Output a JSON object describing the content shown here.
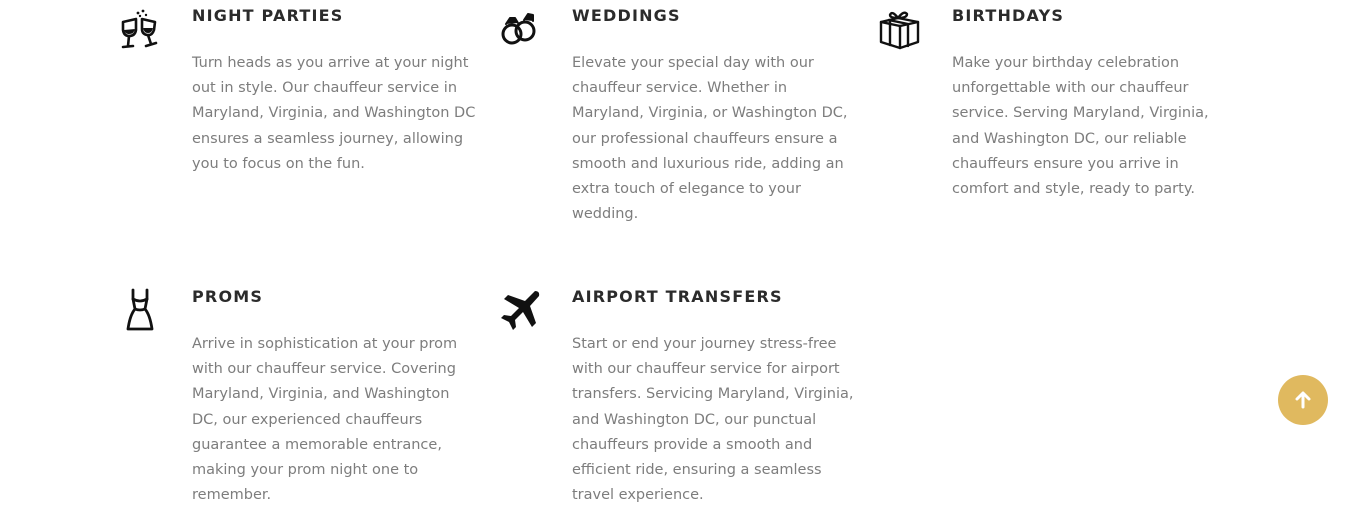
{
  "services": [
    {
      "icon": "champagne-glasses-icon",
      "title": "NIGHT PARTIES",
      "description": "Turn heads as you arrive at your night out in style. Our chauffeur service in Maryland, Virginia, and Washington DC ensures a seamless journey, allowing you to focus on the fun."
    },
    {
      "icon": "wedding-rings-icon",
      "title": "WEDDINGS",
      "description": "Elevate your special day with our chauffeur service. Whether in Maryland, Virginia, or Washington DC, our professional chauffeurs ensure a smooth and luxurious ride, adding an extra touch of elegance to your wedding."
    },
    {
      "icon": "gift-box-icon",
      "title": "BIRTHDAYS",
      "description": "Make your birthday celebration unforgettable with our chauffeur service. Serving Maryland, Virginia, and Washington DC, our reliable chauffeurs ensure you arrive in comfort and style, ready to party."
    },
    {
      "icon": "dress-icon",
      "title": "PROMS",
      "description": "Arrive in sophistication at your prom with our chauffeur service. Covering Maryland, Virginia, and Washington DC, our experienced chauffeurs guarantee a memorable entrance, making your prom night one to remember."
    },
    {
      "icon": "airplane-icon",
      "title": "AIRPORT TRANSFERS",
      "description": "Start or end your journey stress-free with our chauffeur service for airport transfers. Servicing Maryland, Virginia, and Washington DC, our punctual chauffeurs provide a smooth and efficient ride, ensuring a seamless travel experience."
    }
  ],
  "back_to_top": {
    "icon": "arrow-up-icon",
    "color": "#e0b95f"
  },
  "colors": {
    "heading": "#2b2b2b",
    "body_text": "#7d7d7d",
    "icon": "#111111",
    "background": "#ffffff"
  }
}
